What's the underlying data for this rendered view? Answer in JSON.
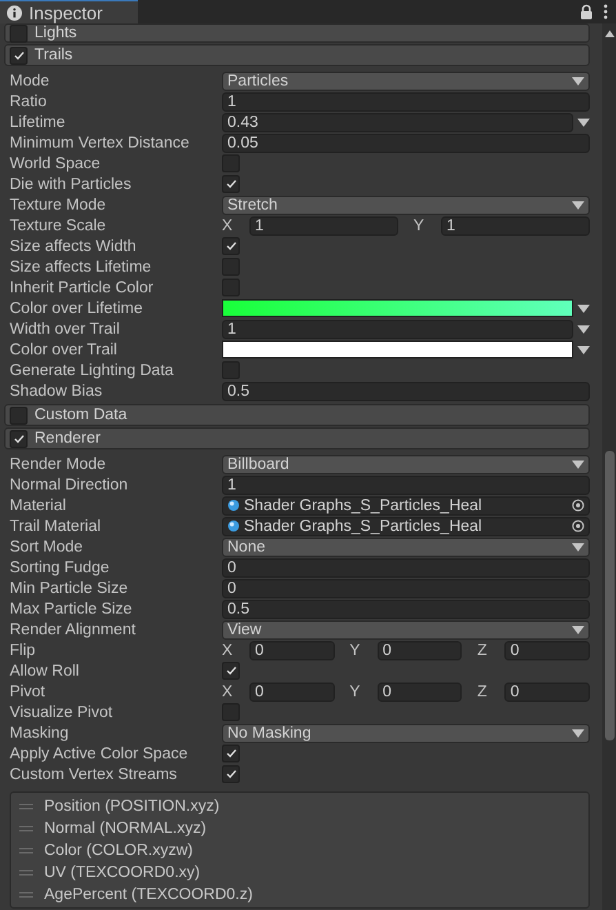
{
  "tab": {
    "title": "Inspector"
  },
  "sections": [
    {
      "title": "Lights",
      "checked": false
    },
    {
      "title": "Trails",
      "checked": true,
      "rows": [
        {
          "kind": "dropdown",
          "label": "Mode",
          "value": "Particles"
        },
        {
          "kind": "field",
          "label": "Ratio",
          "value": "1"
        },
        {
          "kind": "curve",
          "label": "Lifetime",
          "value": "0.43"
        },
        {
          "kind": "field",
          "label": "Minimum Vertex Distance",
          "value": "0.05"
        },
        {
          "kind": "checkbox",
          "label": "World Space",
          "checked": false
        },
        {
          "kind": "checkbox",
          "label": "Die with Particles",
          "checked": true
        },
        {
          "kind": "dropdown",
          "label": "Texture Mode",
          "value": "Stretch"
        },
        {
          "kind": "vector",
          "label": "Texture Scale",
          "components": [
            {
              "axis": "X",
              "value": "1"
            },
            {
              "axis": "Y",
              "value": "1"
            }
          ]
        },
        {
          "kind": "checkbox",
          "label": "Size affects Width",
          "checked": true
        },
        {
          "kind": "checkbox",
          "label": "Size affects Lifetime",
          "checked": false
        },
        {
          "kind": "checkbox",
          "label": "Inherit Particle Color",
          "checked": false
        },
        {
          "kind": "gradient",
          "label": "Color over Lifetime",
          "color": "#19ff3a"
        },
        {
          "kind": "curve",
          "label": "Width over Trail",
          "value": "1"
        },
        {
          "kind": "color",
          "label": "Color over Trail",
          "color": "#ffffff"
        },
        {
          "kind": "checkbox",
          "label": "Generate Lighting Data",
          "checked": false
        },
        {
          "kind": "field",
          "label": "Shadow Bias",
          "value": "0.5"
        }
      ]
    },
    {
      "title": "Custom Data",
      "checked": false
    },
    {
      "title": "Renderer",
      "checked": true,
      "rows": [
        {
          "kind": "dropdown",
          "label": "Render Mode",
          "value": "Billboard"
        },
        {
          "kind": "field",
          "label": "Normal Direction",
          "value": "1"
        },
        {
          "kind": "object",
          "label": "Material",
          "value": "Shader Graphs_S_Particles_Heal"
        },
        {
          "kind": "object",
          "label": "Trail Material",
          "value": "Shader Graphs_S_Particles_Heal"
        },
        {
          "kind": "dropdown",
          "label": "Sort Mode",
          "value": "None"
        },
        {
          "kind": "field",
          "label": "Sorting Fudge",
          "value": "0"
        },
        {
          "kind": "field",
          "label": "Min Particle Size",
          "value": "0"
        },
        {
          "kind": "field",
          "label": "Max Particle Size",
          "value": "0.5"
        },
        {
          "kind": "dropdown",
          "label": "Render Alignment",
          "value": "View"
        },
        {
          "kind": "vector",
          "label": "Flip",
          "components": [
            {
              "axis": "X",
              "value": "0"
            },
            {
              "axis": "Y",
              "value": "0"
            },
            {
              "axis": "Z",
              "value": "0"
            }
          ]
        },
        {
          "kind": "checkbox",
          "label": "Allow Roll",
          "checked": true
        },
        {
          "kind": "vector",
          "label": "Pivot",
          "components": [
            {
              "axis": "X",
              "value": "0"
            },
            {
              "axis": "Y",
              "value": "0"
            },
            {
              "axis": "Z",
              "value": "0"
            }
          ]
        },
        {
          "kind": "checkbox",
          "label": "Visualize Pivot",
          "checked": false
        },
        {
          "kind": "dropdown",
          "label": "Masking",
          "value": "No Masking"
        },
        {
          "kind": "checkbox",
          "label": "Apply Active Color Space",
          "checked": true
        },
        {
          "kind": "checkbox",
          "label": "Custom Vertex Streams",
          "checked": true
        }
      ],
      "streams": [
        "Position (POSITION.xyz)",
        "Normal (NORMAL.xyz)",
        "Color (COLOR.xyzw)",
        "UV (TEXCOORD0.xy)",
        "AgePercent (TEXCOORD0.z)"
      ]
    }
  ]
}
